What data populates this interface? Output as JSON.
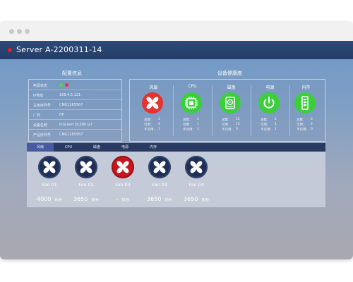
{
  "window": {
    "server_title": "Server A-2200311-14"
  },
  "config": {
    "title": "配置信息",
    "rows": [
      {
        "label": "电源状态",
        "value": ""
      },
      {
        "label": "IP地址",
        "value": "168.4.5.121"
      },
      {
        "label": "主板序列号",
        "value": "CNG1165567"
      },
      {
        "label": "厂商",
        "value": "HP"
      },
      {
        "label": "设备名称",
        "value": "ProLiant DL380 G7"
      },
      {
        "label": "产品序列号",
        "value": "CNG1165567"
      }
    ]
  },
  "health": {
    "title": "设备健康度",
    "columns": [
      {
        "name": "风扇",
        "icon": "fan-icon",
        "color": "#e5332f",
        "stats": [
          {
            "label": "总数：",
            "value": "5"
          },
          {
            "label": "可用：",
            "value": "4"
          },
          {
            "label": "不可用：",
            "value": "1"
          }
        ]
      },
      {
        "name": "CPU",
        "icon": "cpu-icon",
        "color": "#3ccf3c",
        "stats": [
          {
            "label": "总数：",
            "value": "2"
          },
          {
            "label": "可用：",
            "value": "1"
          },
          {
            "label": "不可用：",
            "value": "1"
          }
        ]
      },
      {
        "name": "磁盘",
        "icon": "disk-icon",
        "color": "#3ccf3c",
        "stats": [
          {
            "label": "总数：",
            "value": "15"
          },
          {
            "label": "可用：",
            "value": "15"
          },
          {
            "label": "不可用：",
            "value": "0"
          }
        ]
      },
      {
        "name": "电源",
        "icon": "power-icon",
        "color": "#3ccf3c",
        "stats": [
          {
            "label": "总数：",
            "value": "2"
          },
          {
            "label": "可用：",
            "value": "1"
          },
          {
            "label": "不可用：",
            "value": "1"
          }
        ]
      },
      {
        "name": "内存",
        "icon": "memory-icon",
        "color": "#3ccf3c",
        "stats": [
          {
            "label": "总数：",
            "value": "2"
          },
          {
            "label": "可用：",
            "value": "2"
          },
          {
            "label": "不可用：",
            "value": "0"
          }
        ]
      }
    ]
  },
  "tabs": [
    {
      "label": "风扇",
      "active": true
    },
    {
      "label": "CPU",
      "active": false
    },
    {
      "label": "磁盘",
      "active": false
    },
    {
      "label": "电源",
      "active": false
    },
    {
      "label": "内存",
      "active": false
    }
  ],
  "fans": [
    {
      "name": "Fan 01",
      "speed": "4000",
      "unit": "转/秒",
      "status": "ok"
    },
    {
      "name": "Fan 02",
      "speed": "3650",
      "unit": "转/秒",
      "status": "ok"
    },
    {
      "name": "Fan 03",
      "speed": "-",
      "unit": "转/秒",
      "status": "fault"
    },
    {
      "name": "Fan 04",
      "speed": "3650",
      "unit": "转/秒",
      "status": "ok"
    },
    {
      "name": "Fan 04",
      "speed": "3650",
      "unit": "转/秒",
      "status": "ok"
    }
  ],
  "colors": {
    "fan_ok": "#1f2f55",
    "fan_fault": "#c8161e",
    "title_bar": "#2b4676",
    "tab_active": "#4a5aa0"
  }
}
